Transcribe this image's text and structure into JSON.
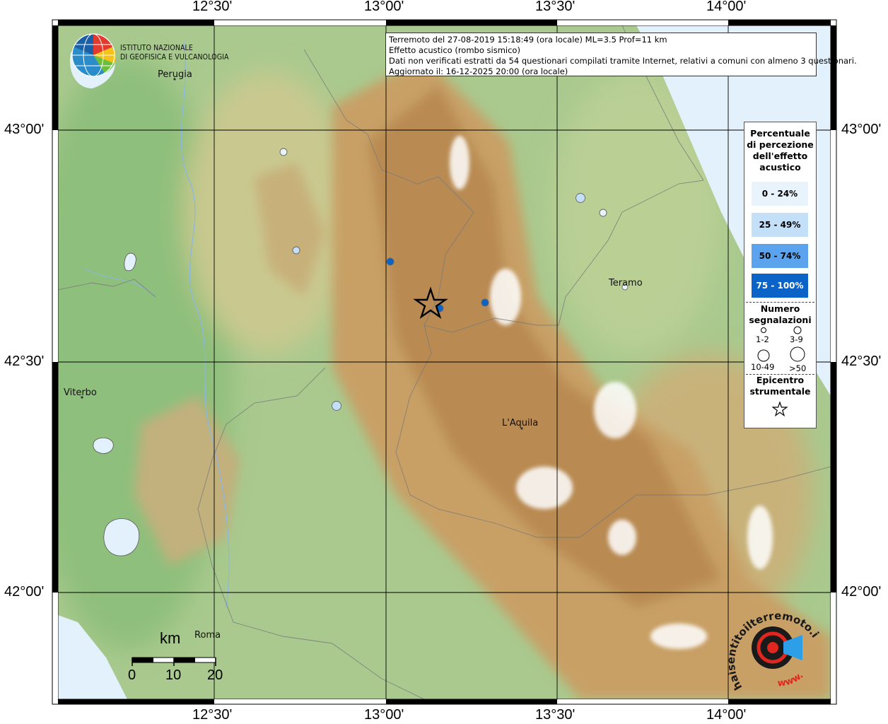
{
  "info": {
    "line1": "Terremoto del 27-08-2019 15:18:49 (ora locale) ML=3.5 Prof=11 km",
    "line2": "Effetto acustico (rombo sismico)",
    "line3": "Dati non verificati estratti da 54 questionari compilati tramite Internet, relativi a comuni con almeno 3 questionari.",
    "line4": "Aggiornato il: 16-12-2025 20:00 (ora locale)"
  },
  "logo": {
    "line1": "ISTITUTO NAZIONALE",
    "line2": "DI GEOFISICA E VULCANOLOGIA"
  },
  "coords": {
    "lon": [
      "12°30'",
      "13°00'",
      "13°30'",
      "14°00'"
    ],
    "lat": [
      "43°00'",
      "42°30'",
      "42°00'"
    ]
  },
  "cities": {
    "perugia": "Perugia",
    "teramo": "Teramo",
    "viterbo": "Viterbo",
    "laquila": "L'Aquila",
    "roma": "Roma"
  },
  "legend": {
    "title_l1": "Percentuale",
    "title_l2": "di percezione",
    "title_l3": "dell'effetto",
    "title_l4": "acustico",
    "bins": [
      {
        "label": "0 - 24%",
        "color": "#e8f3fc"
      },
      {
        "label": "25 - 49%",
        "color": "#c4dff8"
      },
      {
        "label": "50 - 74%",
        "color": "#5ba3ec"
      },
      {
        "label": "75 - 100%",
        "color": "#0b63c8"
      }
    ],
    "count_title_l1": "Numero",
    "count_title_l2": "segnalazioni",
    "counts": [
      "1-2",
      "3-9",
      "10-49",
      ">50"
    ],
    "epi_title_l1": "Epicentro",
    "epi_title_l2": "strumentale"
  },
  "scale": {
    "unit": "km",
    "ticks": [
      "0",
      "10",
      "20"
    ]
  },
  "watermark": {
    "text_top": "haisentitoilterremoto.it",
    "text_bottom": "www."
  }
}
